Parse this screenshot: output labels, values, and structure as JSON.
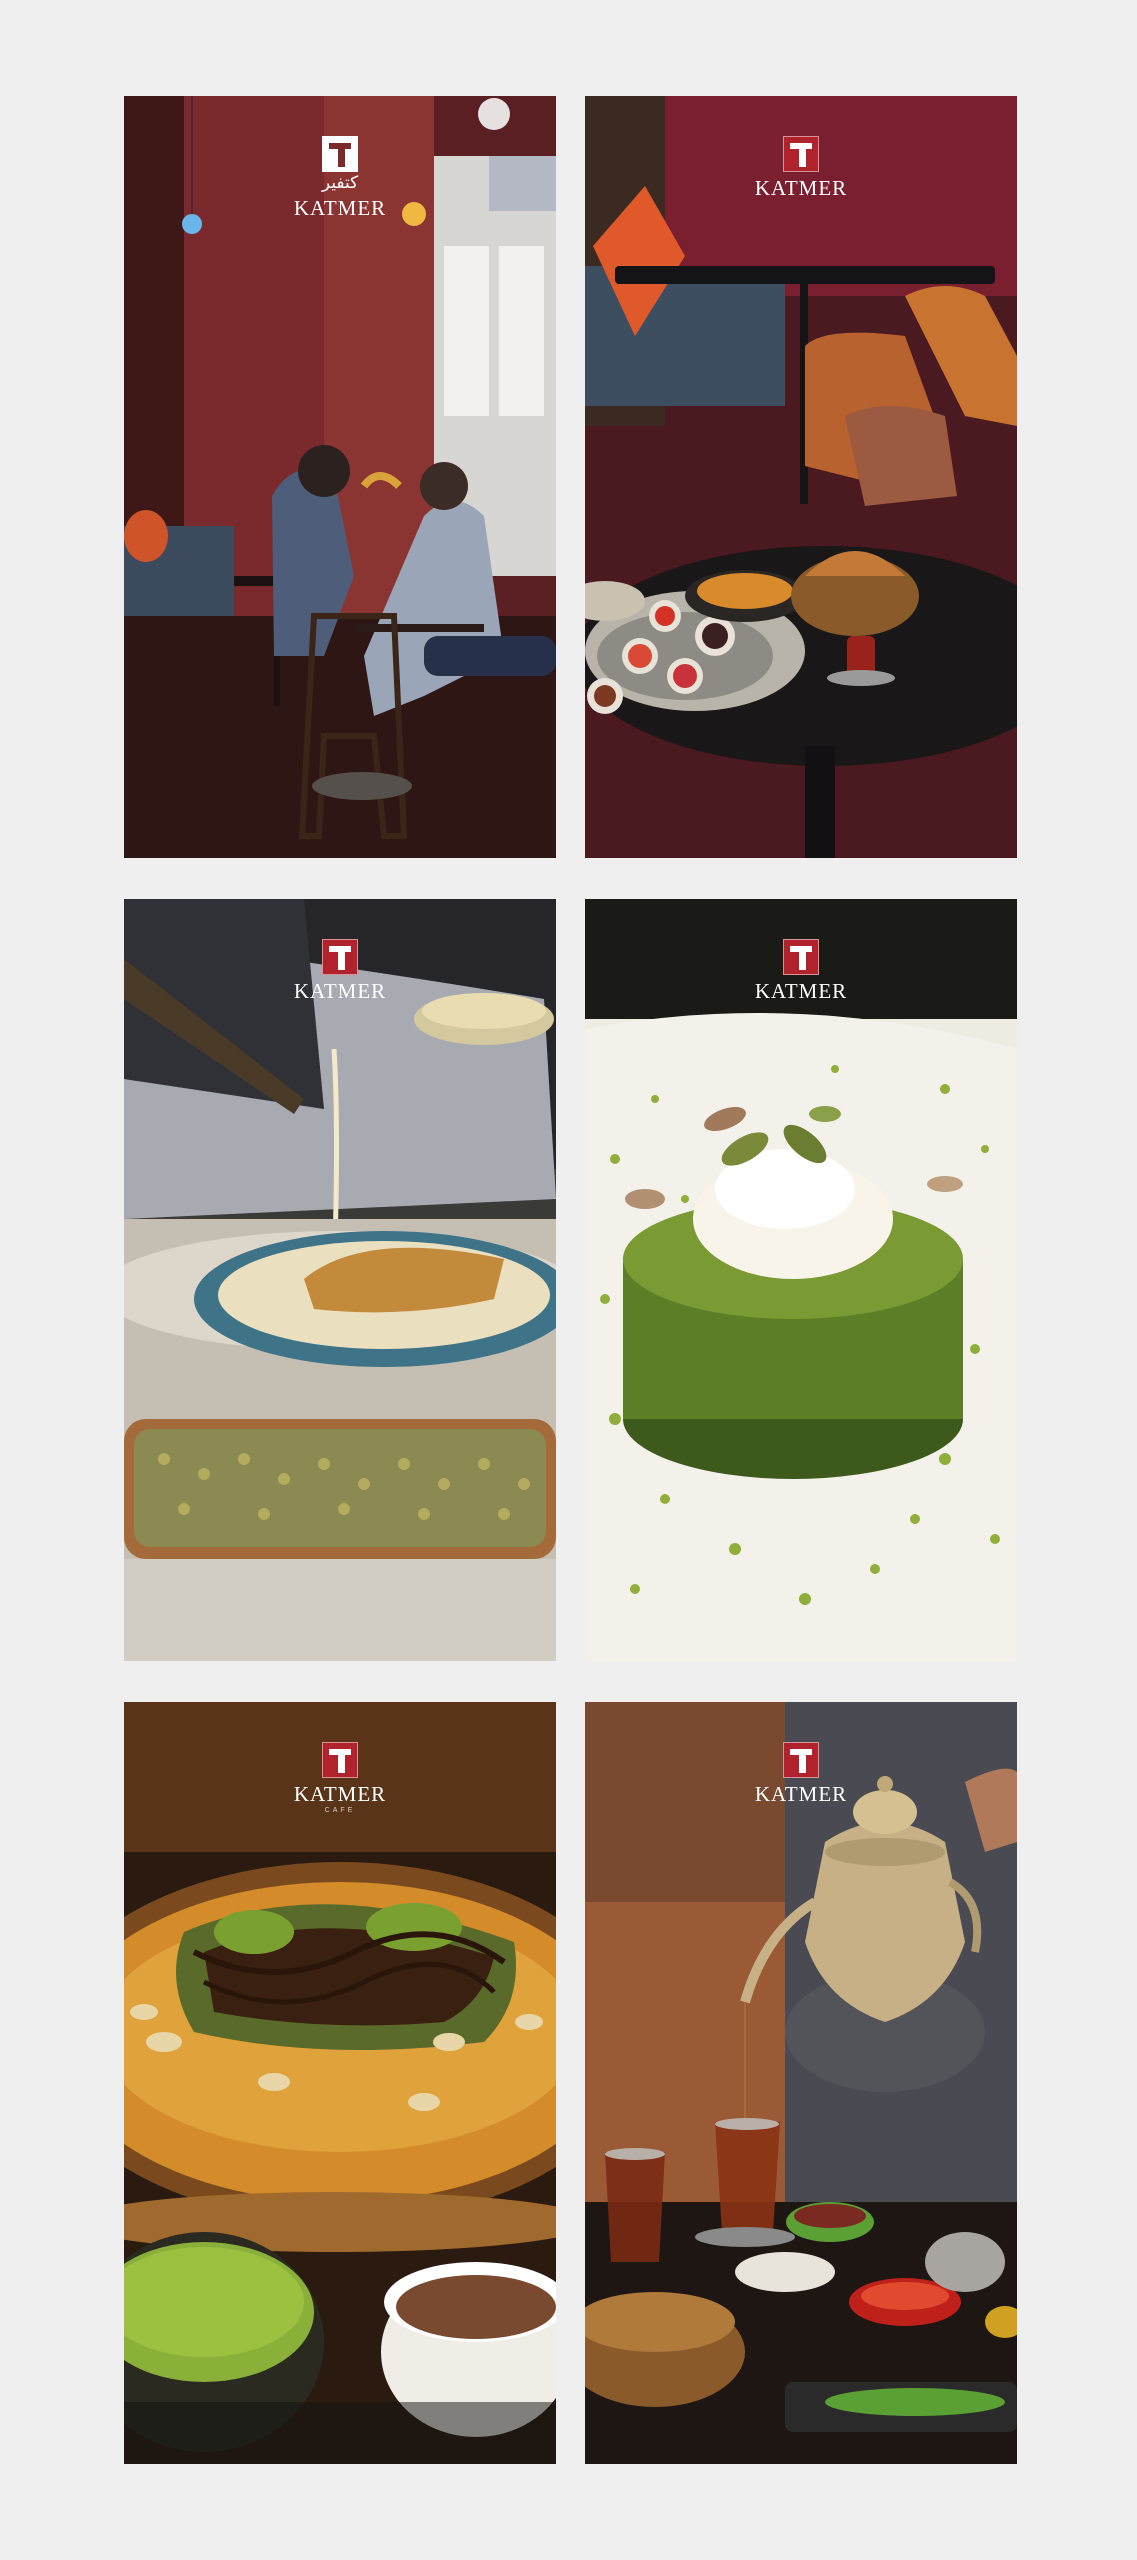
{
  "brand": {
    "name": "KATMER",
    "arabic_name": "كتفير",
    "sub_label": "CAFE",
    "accent_color": "#b0232c"
  },
  "tiles": [
    {
      "id": "dining-room",
      "logo_style": "white-mark-arabic",
      "logo_icon": "katmer-logo-icon"
    },
    {
      "id": "breakfast-table",
      "logo_style": "red-mark",
      "logo_icon": "katmer-logo-icon"
    },
    {
      "id": "cream-pour-dessert",
      "logo_style": "red-mark",
      "logo_icon": "katmer-logo-icon"
    },
    {
      "id": "pistachio-kunafa",
      "logo_style": "red-mark",
      "logo_icon": "katmer-logo-icon"
    },
    {
      "id": "chocolate-katmer",
      "logo_style": "red-mark-sub",
      "logo_icon": "katmer-logo-icon"
    },
    {
      "id": "turkish-tea-pour",
      "logo_style": "red-mark",
      "logo_icon": "katmer-logo-icon"
    }
  ]
}
